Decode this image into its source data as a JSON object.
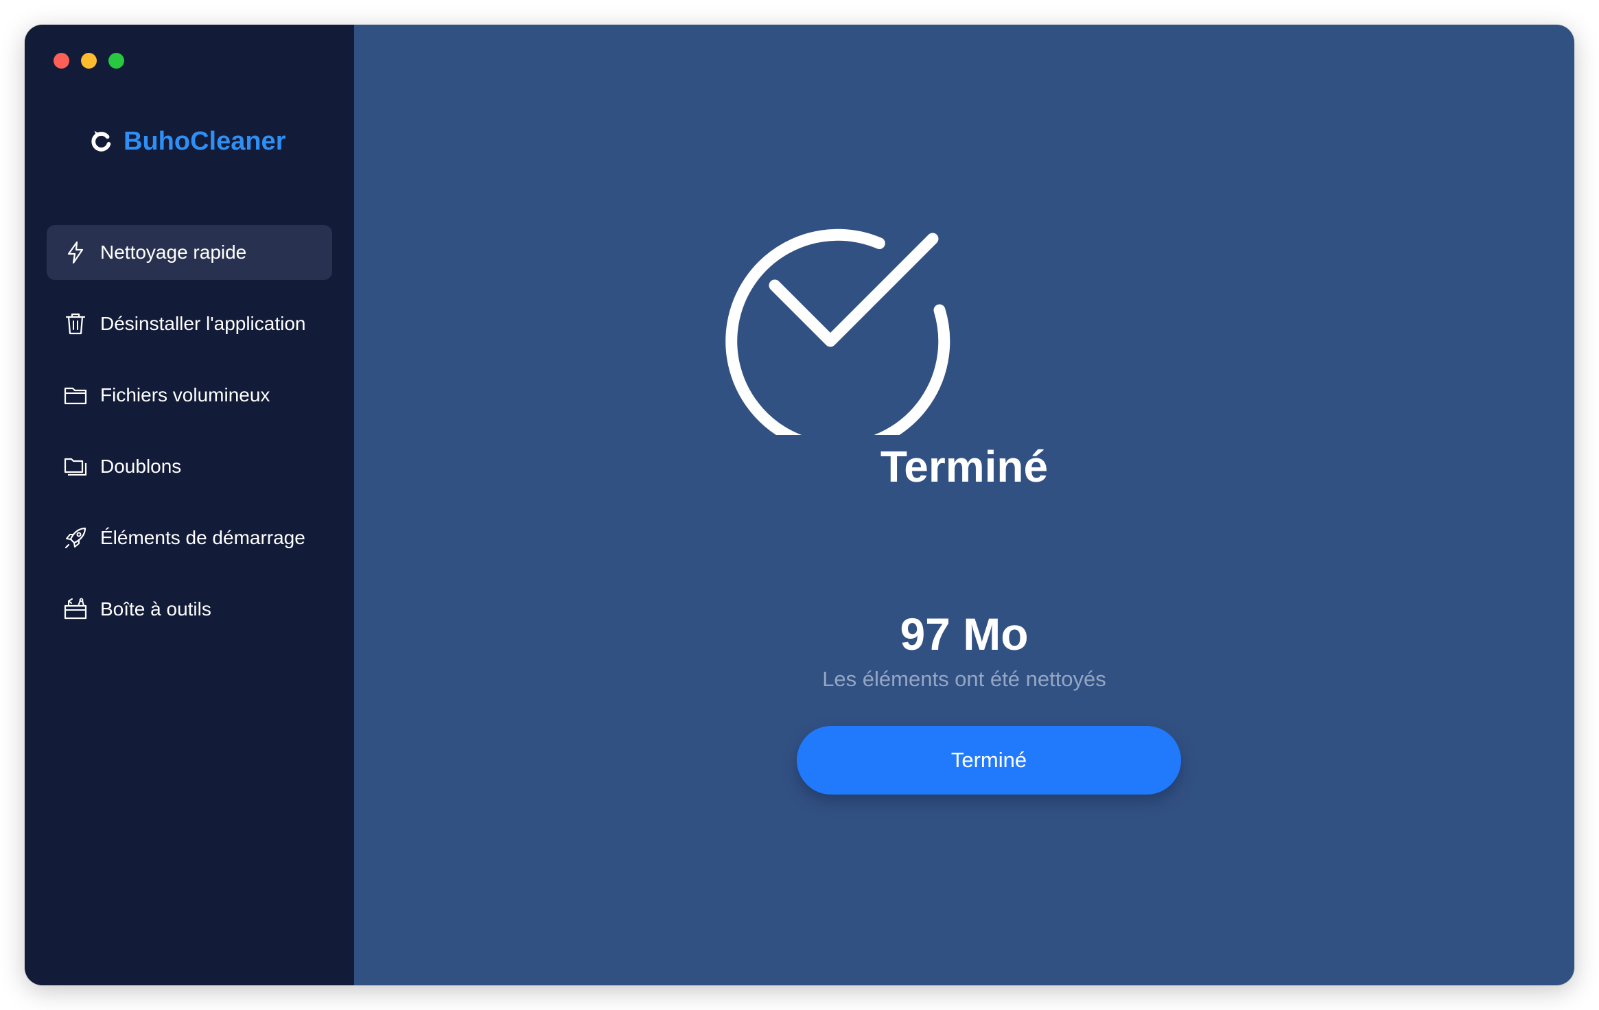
{
  "app": {
    "name": "BuhoCleaner",
    "accent_color": "#2e8ff5"
  },
  "window_controls": [
    "close",
    "minimize",
    "maximize"
  ],
  "sidebar": {
    "items": [
      {
        "label": "Nettoyage rapide",
        "icon": "lightning-icon",
        "active": true
      },
      {
        "label": "Désinstaller l'application",
        "icon": "trash-icon",
        "active": false
      },
      {
        "label": "Fichiers volumineux",
        "icon": "folder-icon",
        "active": false
      },
      {
        "label": "Doublons",
        "icon": "duplicate-folder-icon",
        "active": false
      },
      {
        "label": "Éléments de démarrage",
        "icon": "rocket-icon",
        "active": false
      },
      {
        "label": "Boîte à outils",
        "icon": "toolbox-icon",
        "active": false
      }
    ]
  },
  "main": {
    "status_icon": "check-circle-icon",
    "title": "Terminé",
    "cleaned_size": "97 Mo",
    "cleaned_caption": "Les éléments ont été nettoyés",
    "done_button": "Terminé",
    "button_color": "#217afb",
    "background_color": "#325183"
  }
}
